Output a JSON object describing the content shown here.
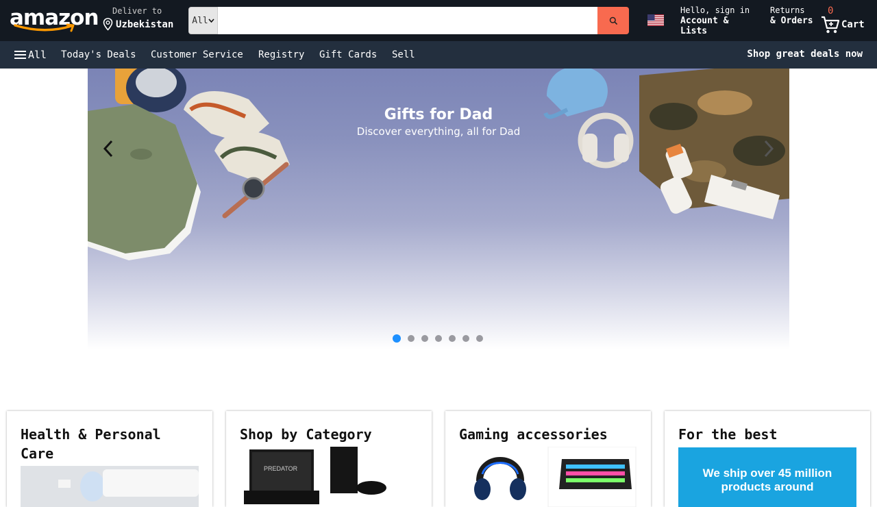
{
  "header": {
    "logo_text": "amazon",
    "deliver_label": "Deliver to",
    "deliver_location": "Uzbekistan",
    "search_category": "All",
    "search_placeholder": "",
    "account_greeting": "Hello, sign in",
    "account_label": "Account & Lists",
    "returns_label": "Returns",
    "orders_label": "& Orders",
    "cart_count": "0",
    "cart_label": "Cart",
    "flag_icon": "us-flag-icon"
  },
  "subnav": {
    "all_label": "All",
    "items": [
      "Today's Deals",
      "Customer Service",
      "Registry",
      "Gift Cards",
      "Sell"
    ],
    "promo": "Shop great deals now"
  },
  "hero": {
    "title": "Gifts for Dad",
    "subtitle": "Discover everything, all for Dad",
    "slide_count": 7,
    "active_slide": 1
  },
  "cards": [
    {
      "title": "Health & Personal Care"
    },
    {
      "title": "Shop by Category"
    },
    {
      "title": "Gaming accessories"
    },
    {
      "title": "For the best",
      "banner_text": "We ship over 45 million products around"
    }
  ],
  "colors": {
    "header_bg": "#131921",
    "subnav_bg": "#232f3e",
    "accent": "#f86a4f",
    "active_dot": "#1e90ff"
  }
}
